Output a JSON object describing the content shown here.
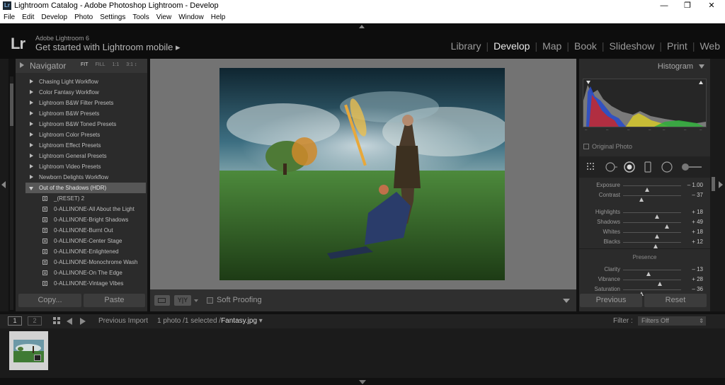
{
  "window": {
    "title": "Lightroom Catalog - Adobe Photoshop Lightroom - Develop",
    "app_icon": "Lr",
    "controls": [
      "—",
      "❐",
      "✕"
    ]
  },
  "menu": [
    "File",
    "Edit",
    "Develop",
    "Photo",
    "Settings",
    "Tools",
    "View",
    "Window",
    "Help"
  ],
  "identity": {
    "logo": "Lr",
    "version": "Adobe Lightroom 6",
    "mobile": "Get started with Lightroom mobile ▸"
  },
  "modules": [
    "Library",
    "Develop",
    "Map",
    "Book",
    "Slideshow",
    "Print",
    "Web"
  ],
  "active_module": "Develop",
  "navigator": {
    "label": "Navigator",
    "zooms": [
      "FIT",
      "FILL",
      "1:1",
      "3:1 ↕"
    ]
  },
  "presets": {
    "folders": [
      "Chasing Light Workflow",
      "Color Fantasy Workflow",
      "Lightroom B&W Filter Presets",
      "Lightroom B&W Presets",
      "Lightroom B&W Toned Presets",
      "Lightroom Color Presets",
      "Lightroom Effect Presets",
      "Lightroom General Presets",
      "Lightroom Video Presets",
      "Newborn Delights Workflow"
    ],
    "open_folder": "Out of the Shadows (HDR)",
    "children": [
      "_(RESET) 2",
      "0-ALLINONE-All About the Light",
      "0-ALLINONE-Bright Shadows",
      "0-ALLINONE-Burnt Out",
      "0-ALLINONE-Center Stage",
      "0-ALLINONE-Enlightened",
      "0-ALLINONE-Monochrome Wash",
      "0-ALLINONE-On The Edge",
      "0-ALLINONE-Vintage Vibes"
    ]
  },
  "left_buttons": {
    "copy": "Copy...",
    "paste": "Paste"
  },
  "toolbar": {
    "yy": "Y|Y",
    "soft_proofing": "Soft Proofing"
  },
  "histogram": {
    "label": "Histogram",
    "original_photo": "Original Photo",
    "ticks": [
      "–",
      "–",
      "–",
      "–",
      "–",
      "–",
      "–"
    ]
  },
  "tools": [
    "crop-overlay-icon",
    "spot-removal-icon",
    "red-eye-icon",
    "graduated-filter-icon",
    "radial-filter-icon",
    "adjustment-brush-icon"
  ],
  "basic": {
    "sliders": [
      {
        "name": "Exposure",
        "value": "– 1.00",
        "level": 0.42
      },
      {
        "name": "Contrast",
        "value": "– 37",
        "level": 0.32
      },
      {
        "name": "Highlights",
        "value": "+ 18",
        "level": 0.58
      },
      {
        "name": "Shadows",
        "value": "+ 49",
        "level": 0.75
      },
      {
        "name": "Whites",
        "value": "+ 18",
        "level": 0.58
      },
      {
        "name": "Blacks",
        "value": "+ 12",
        "level": 0.56
      }
    ],
    "presence_label": "Presence",
    "presence_sliders": [
      {
        "name": "Clarity",
        "value": "– 13",
        "level": 0.44
      },
      {
        "name": "Vibrance",
        "value": "+ 28",
        "level": 0.64
      },
      {
        "name": "Saturation",
        "value": "– 36",
        "level": 0.32
      }
    ]
  },
  "right_buttons": {
    "previous": "Previous",
    "reset": "Reset"
  },
  "filmstrip": {
    "page1": "1",
    "page2": "2",
    "source": "Previous Import",
    "info_prefix": "1 photo /1 selected /",
    "filename": "Fantasy.jpg",
    "filter_label": "Filter :",
    "filter_value": "Filters Off"
  },
  "colors": {
    "panel": "#2b2b2b",
    "canvas": "#737373",
    "selection": "#575757"
  }
}
